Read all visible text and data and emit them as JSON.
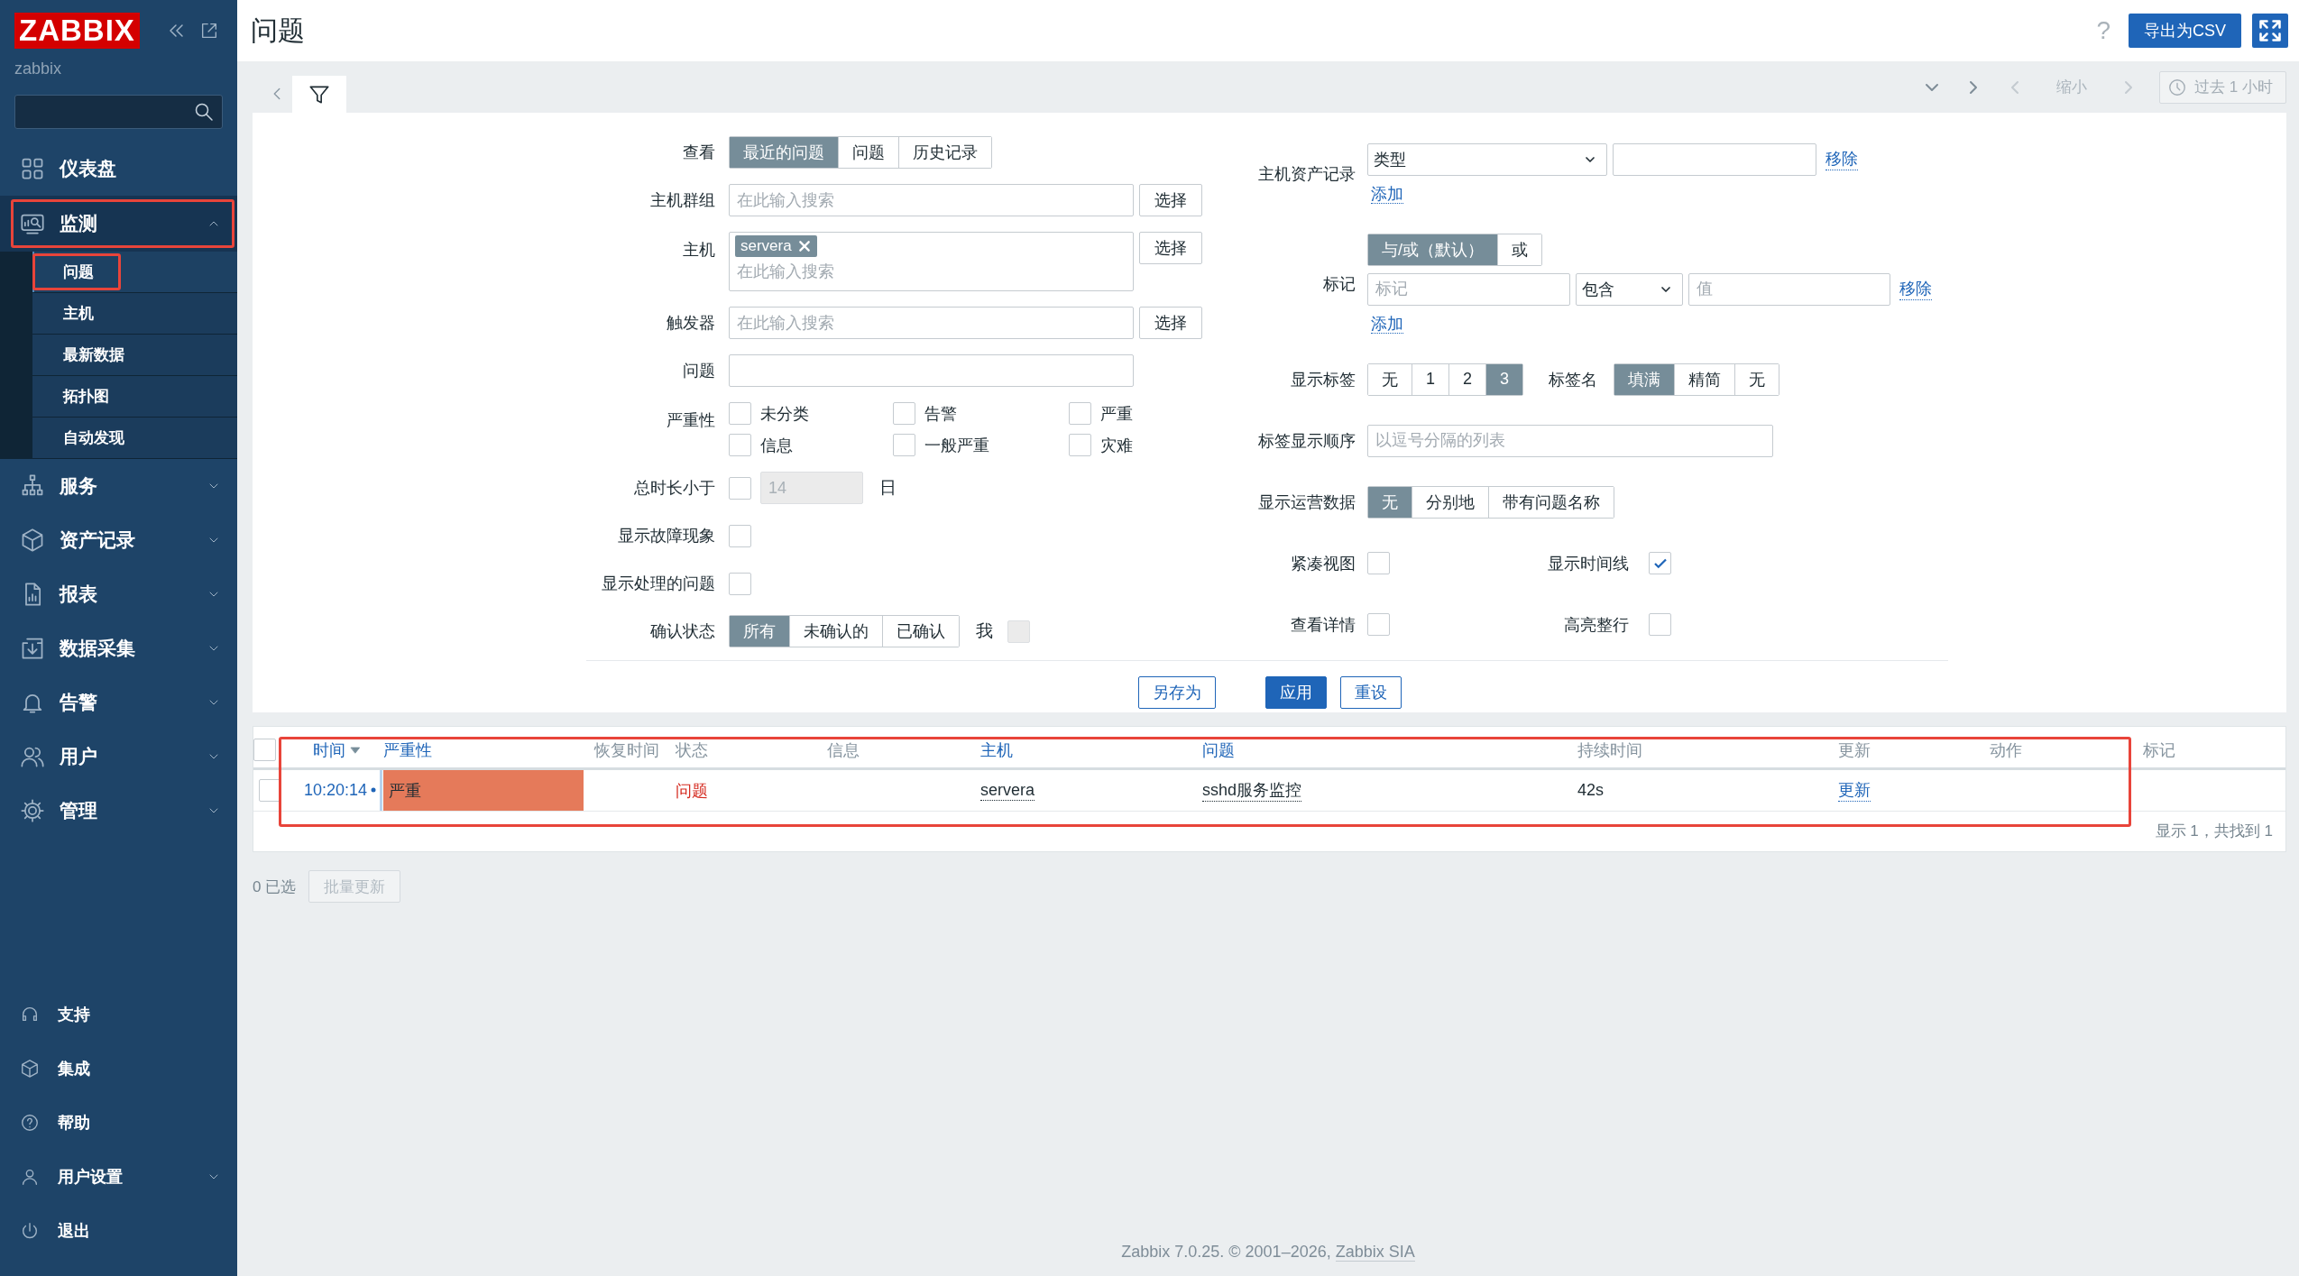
{
  "sidebar": {
    "logo": "ZABBIX",
    "server_name": "zabbix",
    "menu": [
      {
        "label": "仪表盘",
        "kind": "link",
        "expanded": false,
        "highlighted": false
      },
      {
        "label": "监测",
        "kind": "group",
        "expanded": true,
        "highlighted": true,
        "children": [
          {
            "label": "问题",
            "selected": true,
            "highlighted": true
          },
          {
            "label": "主机",
            "selected": false,
            "highlighted": false
          },
          {
            "label": "最新数据",
            "selected": false,
            "highlighted": false
          },
          {
            "label": "拓扑图",
            "selected": false,
            "highlighted": false
          },
          {
            "label": "自动发现",
            "selected": false,
            "highlighted": false
          }
        ]
      },
      {
        "label": "服务",
        "kind": "group",
        "expanded": false,
        "highlighted": false
      },
      {
        "label": "资产记录",
        "kind": "group",
        "expanded": false,
        "highlighted": false
      },
      {
        "label": "报表",
        "kind": "group",
        "expanded": false,
        "highlighted": false
      },
      {
        "label": "数据采集",
        "kind": "group",
        "expanded": false,
        "highlighted": false
      },
      {
        "label": "告警",
        "kind": "group",
        "expanded": false,
        "highlighted": false
      },
      {
        "label": "用户",
        "kind": "group",
        "expanded": false,
        "highlighted": false
      },
      {
        "label": "管理",
        "kind": "group",
        "expanded": false,
        "highlighted": false
      }
    ],
    "bottom_menu": [
      {
        "label": "支持",
        "kind": "link",
        "expanded": false
      },
      {
        "label": "集成",
        "kind": "link",
        "expanded": false
      },
      {
        "label": "帮助",
        "kind": "link",
        "expanded": false
      },
      {
        "label": "用户设置",
        "kind": "group",
        "expanded": false
      },
      {
        "label": "退出",
        "kind": "link",
        "expanded": false
      }
    ]
  },
  "header": {
    "title": "问题",
    "help": "?",
    "export_button": "导出为CSV"
  },
  "time_bar": {
    "zoom_out": "缩小",
    "time_range": "过去 1 小时"
  },
  "filter": {
    "view": {
      "label": "查看",
      "options": [
        {
          "label": "最近的问题",
          "selected": true
        },
        {
          "label": "问题",
          "selected": false
        },
        {
          "label": "历史记录",
          "selected": false
        }
      ]
    },
    "host_groups": {
      "label": "主机群组",
      "placeholder": "在此输入搜索",
      "button": "选择"
    },
    "hosts": {
      "label": "主机",
      "tags": [
        "servera"
      ],
      "placeholder": "在此输入搜索",
      "button": "选择"
    },
    "triggers": {
      "label": "触发器",
      "placeholder": "在此输入搜索",
      "button": "选择"
    },
    "problem": {
      "label": "问题"
    },
    "severity": {
      "label": "严重性",
      "options": [
        {
          "label": "未分类",
          "checked": false
        },
        {
          "label": "告警",
          "checked": false
        },
        {
          "label": "严重",
          "checked": false
        },
        {
          "label": "信息",
          "checked": false
        },
        {
          "label": "一般严重",
          "checked": false
        },
        {
          "label": "灾难",
          "checked": false
        }
      ]
    },
    "age": {
      "label": "总时长小于",
      "checked": false,
      "value": "14",
      "unit": "日"
    },
    "show_symptoms": {
      "label": "显示故障现象",
      "checked": false
    },
    "show_suppressed": {
      "label": "显示处理的问题",
      "checked": false
    },
    "ack_status": {
      "label": "确认状态",
      "options": [
        {
          "label": "所有",
          "selected": true
        },
        {
          "label": "未确认的",
          "selected": false
        },
        {
          "label": "已确认",
          "selected": false
        }
      ],
      "by_me": {
        "label": "我",
        "checked": false,
        "disabled": true
      }
    },
    "inventory": {
      "label": "主机资产记录",
      "rows": [
        {
          "field": "类型",
          "remove": "移除"
        }
      ],
      "add": "添加"
    },
    "tags": {
      "label": "标记",
      "operators": [
        {
          "label": "与/或（默认）",
          "selected": true
        },
        {
          "label": "或",
          "selected": false
        }
      ],
      "rows": [
        {
          "tag_placeholder": "标记",
          "operator": "包含",
          "value_placeholder": "值",
          "remove": "移除"
        }
      ],
      "add": "添加"
    },
    "show_tags": {
      "label": "显示标签",
      "options": [
        {
          "label": "无",
          "selected": false
        },
        {
          "label": "1",
          "selected": false
        },
        {
          "label": "2",
          "selected": false
        },
        {
          "label": "3",
          "selected": true
        }
      ]
    },
    "tag_name": {
      "label": "标签名",
      "options": [
        {
          "label": "填满",
          "selected": true
        },
        {
          "label": "精简",
          "selected": false
        },
        {
          "label": "无",
          "selected": false
        }
      ]
    },
    "tag_priority": {
      "label": "标签显示顺序",
      "placeholder": "以逗号分隔的列表"
    },
    "show_opdata": {
      "label": "显示运营数据",
      "options": [
        {
          "label": "无",
          "selected": true
        },
        {
          "label": "分别地",
          "selected": false
        },
        {
          "label": "带有问题名称",
          "selected": false
        }
      ]
    },
    "compact_view": {
      "label": "紧凑视图",
      "checked": false
    },
    "show_timeline": {
      "label": "显示时间线",
      "checked": true
    },
    "details": {
      "label": "查看详情",
      "checked": false
    },
    "highlight_row": {
      "label": "高亮整行",
      "checked": false
    },
    "buttons": [
      {
        "label": "另存为",
        "kind": "secondary"
      },
      {
        "label": "应用",
        "kind": "primary"
      },
      {
        "label": "重设",
        "kind": "secondary"
      }
    ]
  },
  "problems": {
    "highlighted": true,
    "select_all": {
      "checked": false
    },
    "columns": [
      {
        "label": "时间",
        "sortable": true,
        "sorted": true
      },
      {
        "label": "严重性",
        "sortable": true,
        "sorted": false
      },
      {
        "label": "恢复时间",
        "sortable": false,
        "sorted": false
      },
      {
        "label": "状态",
        "sortable": false,
        "sorted": false
      },
      {
        "label": "信息",
        "sortable": false,
        "sorted": false
      },
      {
        "label": "主机",
        "sortable": true,
        "sorted": false
      },
      {
        "label": "问题",
        "sortable": true,
        "sorted": false
      },
      {
        "label": "持续时间",
        "sortable": false,
        "sorted": false
      },
      {
        "label": "更新",
        "sortable": false,
        "sorted": false
      },
      {
        "label": "动作",
        "sortable": false,
        "sorted": false
      },
      {
        "label": "标记",
        "sortable": false,
        "sorted": false
      }
    ],
    "rows": [
      {
        "checked": false,
        "time": "10:20:14",
        "severity": "严重",
        "color": "#e57a5a",
        "status": "问题",
        "host": "servera",
        "problem": "sshd服务监控",
        "duration": "42s",
        "update": "更新"
      }
    ],
    "summary": "显示 1，共找到 1",
    "selected_count": "0 已选",
    "mass_update": {
      "label": "批量更新",
      "disabled": true
    }
  },
  "footer": {
    "text": "Zabbix 7.0.25. © 2001–2026,",
    "link": "Zabbix SIA"
  }
}
